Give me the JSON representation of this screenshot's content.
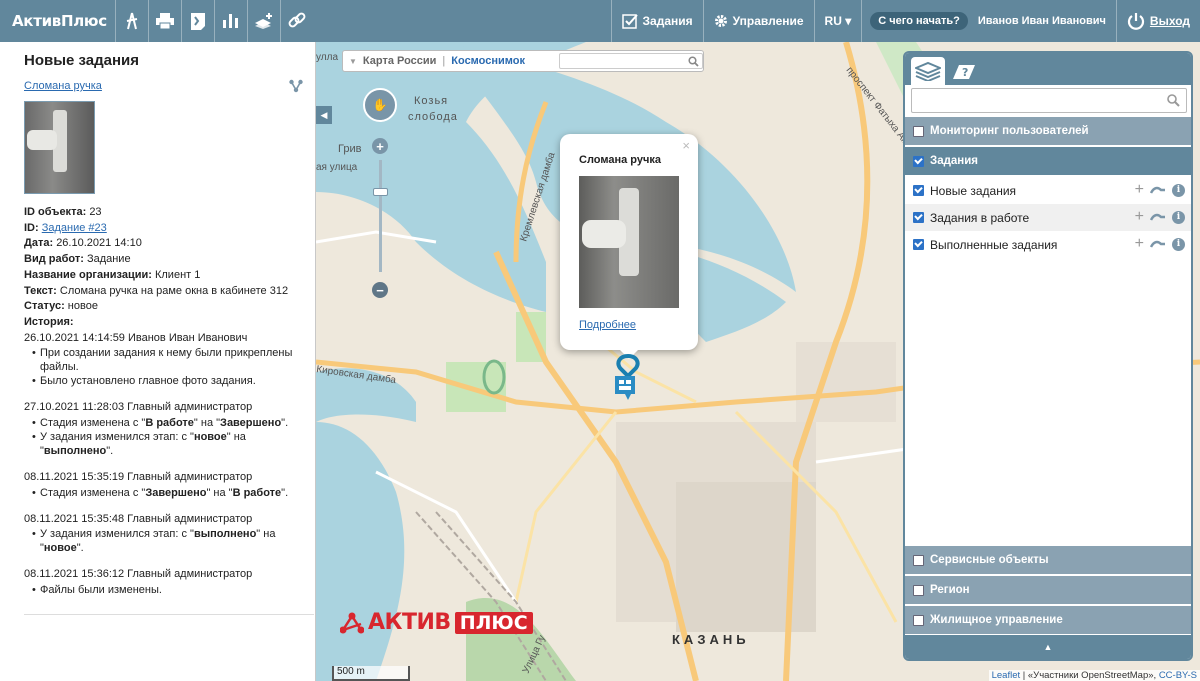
{
  "topbar": {
    "brand": "АктивПлюс",
    "tasks_label": "Задания",
    "manage_label": "Управление",
    "lang_label": "RU ▾",
    "help_label": "С чего начать?",
    "user_name": "Иванов Иван Иванович",
    "exit_label": "Выход"
  },
  "left_panel": {
    "title": "Новые задания",
    "task_link": "Сломана ручка",
    "fields": [
      {
        "label": "ID объекта:",
        "value": "23"
      },
      {
        "label": "ID:",
        "value": "Задание #23",
        "link": true
      },
      {
        "label": "Дата:",
        "value": "26.10.2021 14:10"
      },
      {
        "label": "Вид работ:",
        "value": "Задание"
      },
      {
        "label": "Название организации:",
        "value": "Клиент 1"
      },
      {
        "label": "Текст:",
        "value": "Сломана ручка на раме окна в кабинете 312"
      },
      {
        "label": "Статус:",
        "value": "новое"
      }
    ],
    "history_label": "История:",
    "history": [
      {
        "header": "26.10.2021 14:14:59 Иванов Иван Иванович",
        "items": [
          "При создании задания к нему были прикреплены файлы.",
          "Было установлено главное фото задания."
        ]
      },
      {
        "header": "27.10.2021 11:28:03 Главный администратор",
        "items_html": [
          "Стадия изменена с \"<b>В работе</b>\" на \"<b>Завершено</b>\".",
          "У задания изменился этап: с \"<b>новое</b>\" на \"<b>выполнено</b>\"."
        ]
      },
      {
        "header": "08.11.2021 15:35:19 Главный администратор",
        "items_html": [
          "Стадия изменена с \"<b>Завершено</b>\" на \"<b>В работе</b>\"."
        ]
      },
      {
        "header": "08.11.2021 15:35:48 Главный администратор",
        "items_html": [
          "У задания изменился этап: с \"<b>выполнено</b>\" на \"<b>новое</b>\"."
        ]
      },
      {
        "header": "08.11.2021 15:36:12 Главный администратор",
        "items": [
          "Файлы были изменены."
        ]
      }
    ]
  },
  "map": {
    "basemap_a": "Карта России",
    "basemap_b": "Космоснимок",
    "labels": {
      "kozya": "Козья",
      "sloboda": "слобода",
      "griv": "Грив",
      "ulitsa": "ая улица",
      "kremlevskaya": "Кремлевская дамба",
      "kirovskaya": "Кировская дамба",
      "prospekt": "проспект Фатыха Амир",
      "ulitsa2": "Улица Гу",
      "ulla": "улла"
    },
    "popup": {
      "title": "Сломана ручка",
      "link": "Подробнее",
      "close": "×"
    },
    "logo_a": "АКТИВ",
    "logo_b": "ПЛЮС",
    "city": "КАЗАНЬ",
    "scale": "500 m",
    "attribution_a": "Leaflet",
    "attribution_b": " | «Участники OpenStreetMap», ",
    "attribution_c": "CC-BY-S"
  },
  "layers": {
    "monitoring": "Мониторинг пользователей",
    "tasks": "Задания",
    "rows": [
      "Новые задания",
      "Задания в работе",
      "Выполненные задания"
    ],
    "service": "Сервисные объекты",
    "region": "Регион",
    "housing": "Жилищное управление"
  }
}
